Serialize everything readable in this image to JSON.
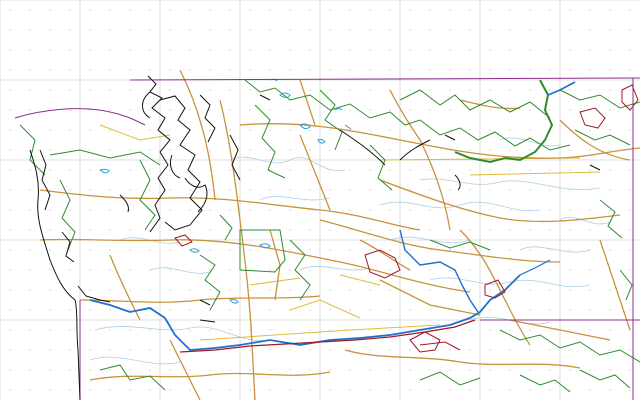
{
  "map": {
    "colors": {
      "background": "#ffffff",
      "grid_major": "#d4d4d4",
      "grid_dot": "#cfcfcf",
      "state_border": "#8a2f8a",
      "coastline": "#111111",
      "highway": "#c8923c",
      "county_road": "#e0bb3a",
      "park_boundary": "#2e8b2e",
      "river_major": "#1f6ed0",
      "lake": "#2aa0e0",
      "minor_stream": "#a9cfe8",
      "tribal_land": "#a01820",
      "rail": "#222222"
    },
    "layers": [
      "state-border",
      "coastline",
      "highways",
      "county-roads",
      "park-boundaries",
      "rivers",
      "lakes",
      "minor-streams",
      "tribal-lands"
    ]
  }
}
